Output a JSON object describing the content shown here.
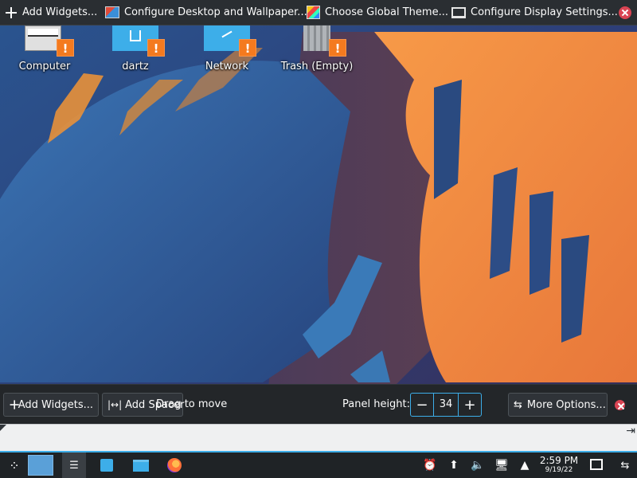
{
  "top_toolbar": {
    "add_widgets": "Add Widgets...",
    "configure_desktop": "Configure Desktop and Wallpaper...",
    "global_theme": "Choose Global Theme...",
    "display_settings": "Configure Display Settings..."
  },
  "desktop_icons": [
    {
      "label": "Computer",
      "icon": "computer-icon"
    },
    {
      "label": "dartz",
      "icon": "home-folder-icon"
    },
    {
      "label": "Network",
      "icon": "network-folder-icon"
    },
    {
      "label": "Trash (Empty)",
      "icon": "trash-icon"
    }
  ],
  "panel_config": {
    "add_widgets": "Add Widgets...",
    "add_spacer": "Add Spacer",
    "drag_hint": "Drag to move",
    "panel_height_label": "Panel height:",
    "panel_height_value": "34",
    "more_options": "More Options..."
  },
  "taskbar": {
    "time": "2:59 PM",
    "date": "9/19/22"
  },
  "colors": {
    "accent": "#3daee9",
    "warning": "#f47a1f",
    "close": "#da4453",
    "panel_bg": "#232629"
  }
}
